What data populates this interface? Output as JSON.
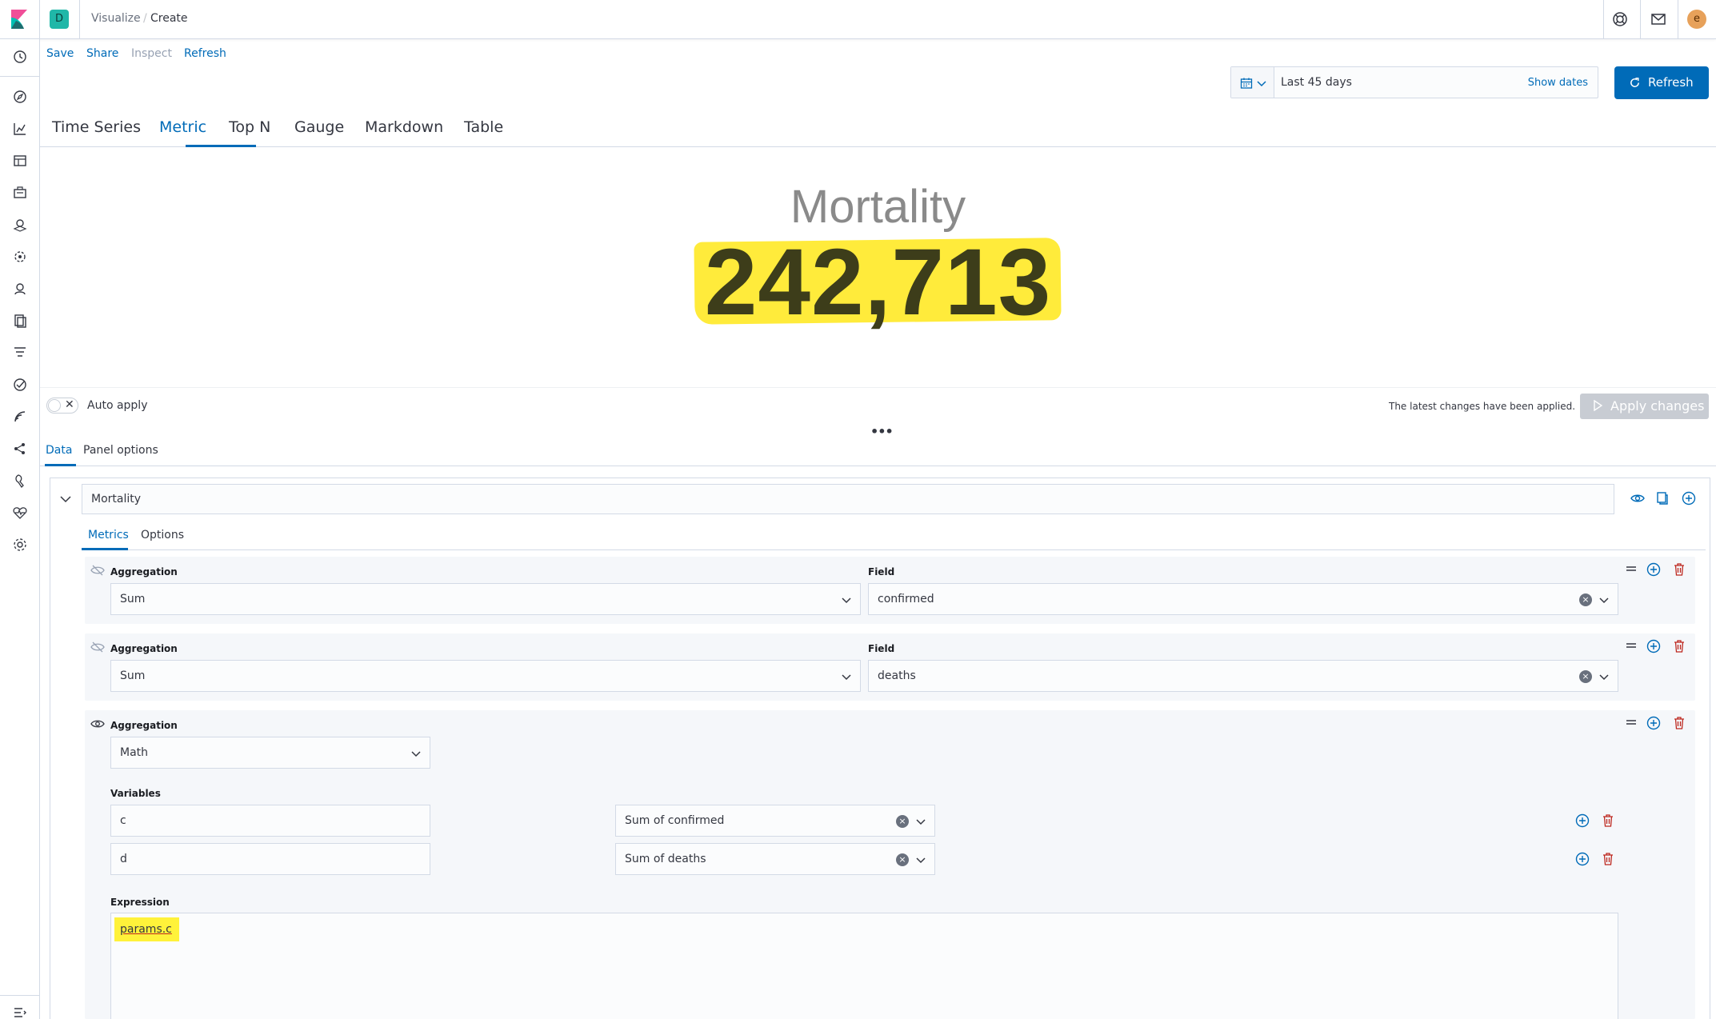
{
  "header": {
    "space_initial": "D",
    "breadcrumbs": [
      "Visualize",
      "Create"
    ],
    "breadcrumb_separator": "/",
    "avatar_initial": "e"
  },
  "top_menu": {
    "save": "Save",
    "share": "Share",
    "inspect": "Inspect",
    "refresh": "Refresh"
  },
  "time_picker": {
    "range_label": "Last 45 days",
    "show_dates": "Show dates",
    "refresh_button": "Refresh"
  },
  "viz_tabs": [
    "Time Series",
    "Metric",
    "Top N",
    "Gauge",
    "Markdown",
    "Table"
  ],
  "viz_active_tab": "Metric",
  "preview": {
    "label": "Mortality",
    "value": "242,713",
    "highlight_color": "#ffeb3b"
  },
  "editor": {
    "auto_apply_label": "Auto apply",
    "toggle_off_symbol": "✕",
    "applied_message": "The latest changes have been applied.",
    "apply_button": "Apply changes",
    "resize_handle": "•••",
    "tabs": [
      "Data",
      "Panel options"
    ],
    "active_tab": "Data"
  },
  "series": {
    "name": "Mortality",
    "tabs": [
      "Metrics",
      "Options"
    ],
    "active_tab": "Metrics",
    "metrics": [
      {
        "aggregation_label": "Aggregation",
        "aggregation": "Sum",
        "field_label": "Field",
        "field": "confirmed",
        "visible": false
      },
      {
        "aggregation_label": "Aggregation",
        "aggregation": "Sum",
        "field_label": "Field",
        "field": "deaths",
        "visible": false
      },
      {
        "aggregation_label": "Aggregation",
        "aggregation": "Math",
        "visible": true,
        "variables_label": "Variables",
        "variables": [
          {
            "name": "c",
            "metric": "Sum of confirmed"
          },
          {
            "name": "d",
            "metric": "Sum of deaths"
          }
        ],
        "expression_label": "Expression",
        "expression": "params.c"
      }
    ]
  },
  "colors": {
    "primary": "#006bb8",
    "danger": "#bd271e",
    "space_badge": "#20b7a8",
    "avatar": "#e7a15a",
    "disabled_button": "#c8ccd3"
  }
}
